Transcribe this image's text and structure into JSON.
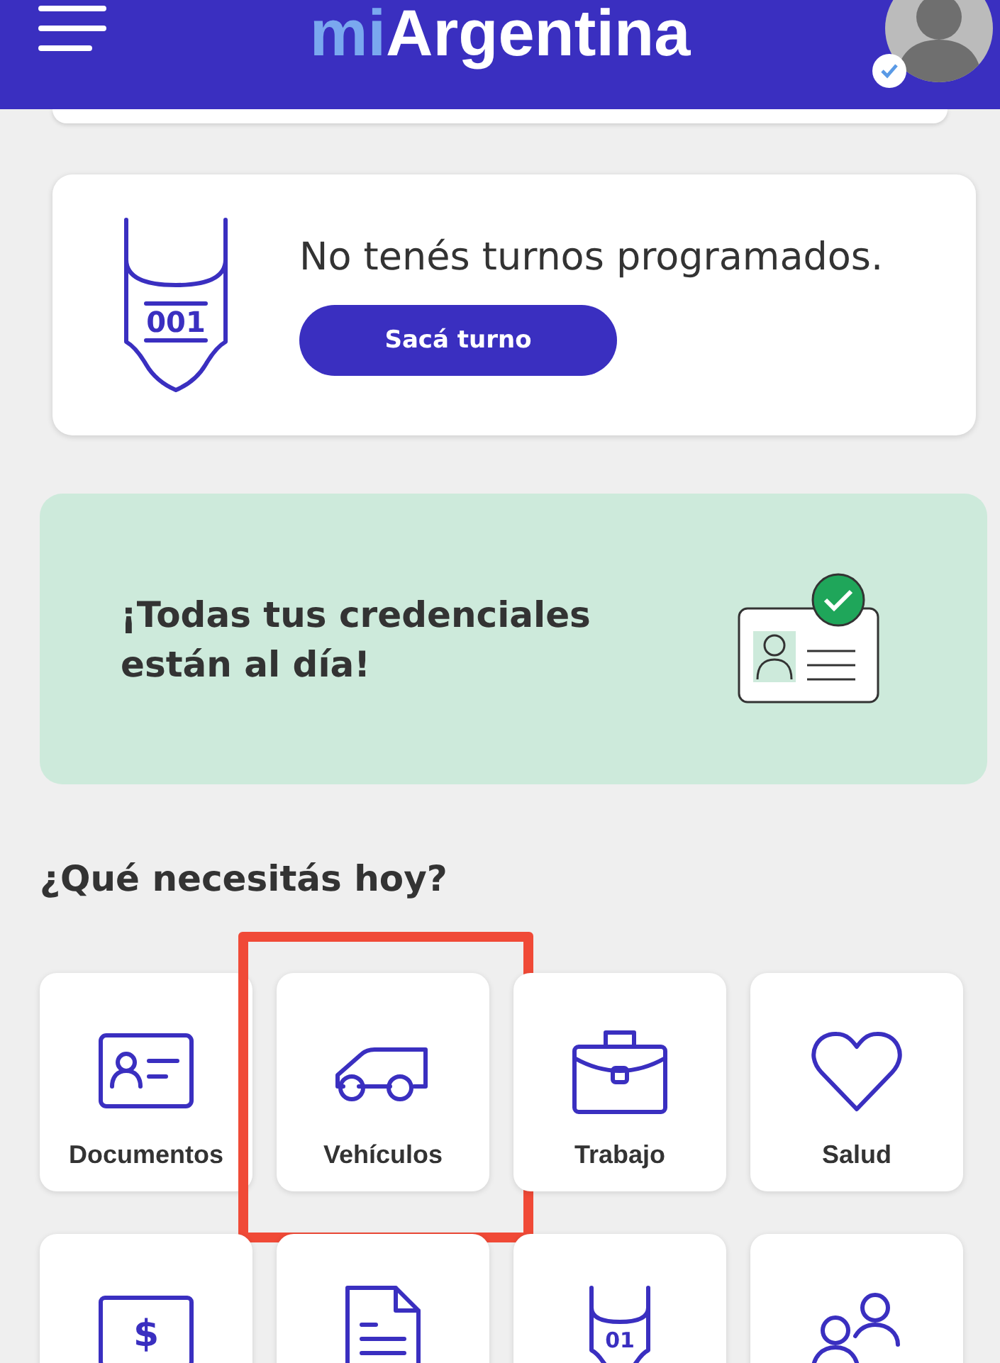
{
  "header": {
    "logo_prefix": "mi",
    "logo_main": "Argentina",
    "verified": true
  },
  "appointments": {
    "ticket_number": "001",
    "message": "No tenés turnos programados.",
    "button": "Sacá turno"
  },
  "credentials": {
    "message": "¡Todas tus credenciales están al día!",
    "verified": true
  },
  "services": {
    "title": "¿Qué necesitás hoy?",
    "items": [
      {
        "kind": "id-card",
        "label": "Documentos",
        "highlighted": false
      },
      {
        "kind": "car",
        "label": "Vehículos",
        "highlighted": true
      },
      {
        "kind": "briefcase",
        "label": "Trabajo",
        "highlighted": false
      },
      {
        "kind": "heart",
        "label": "Salud",
        "highlighted": false
      },
      {
        "kind": "money",
        "symbol": "$",
        "highlighted": false
      },
      {
        "kind": "document",
        "highlighted": false
      },
      {
        "kind": "ticket",
        "symbol": "01",
        "highlighted": false
      },
      {
        "kind": "people",
        "highlighted": false
      }
    ]
  }
}
